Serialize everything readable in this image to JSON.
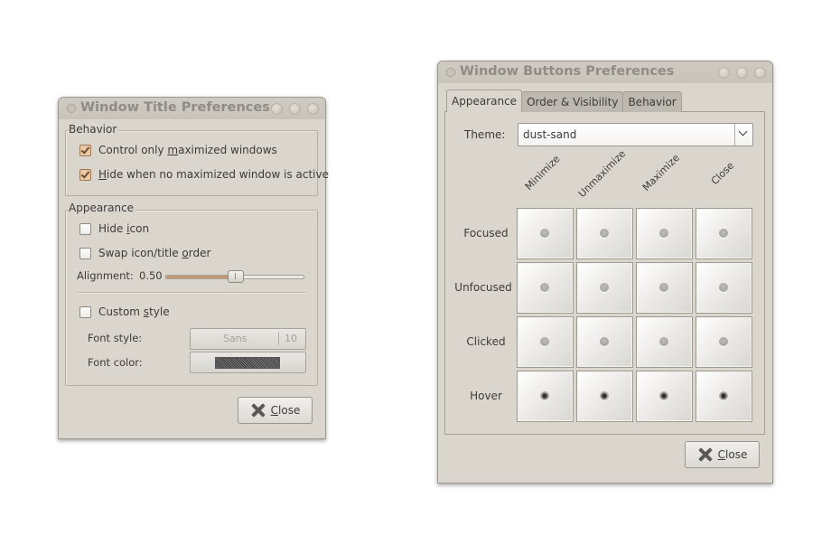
{
  "title_prefs": {
    "title": "Window Title Preferences",
    "behavior": {
      "label": "Behavior",
      "control_maximized": {
        "pre": "Control only ",
        "u": "m",
        "post": "aximized windows",
        "checked": true
      },
      "hide_when": {
        "pre": "",
        "u": "H",
        "post": "ide when no maximized window is active",
        "checked": true
      }
    },
    "appearance": {
      "label": "Appearance",
      "hide_icon": {
        "pre": "Hide ",
        "u": "i",
        "post": "con",
        "checked": false
      },
      "swap_order": {
        "pre": "Swap icon/title ",
        "u": "o",
        "post": "rder",
        "checked": false
      },
      "alignment_label": "Alignment:",
      "alignment_value": "0.50",
      "alignment_fraction": 0.5,
      "custom_style": {
        "pre": "Custom ",
        "u": "s",
        "post": "tyle",
        "checked": false
      },
      "font_style_label": "Font style:",
      "font_name": "Sans",
      "font_size": "10",
      "font_color_label": "Font color:"
    },
    "close": {
      "u": "C",
      "post": "lose"
    }
  },
  "buttons_prefs": {
    "title": "Window Buttons Preferences",
    "tabs": [
      "Appearance",
      "Order & Visibility",
      "Behavior"
    ],
    "active_tab": 0,
    "theme_label": "Theme:",
    "theme_value": "dust-sand",
    "columns": [
      "Minimize",
      "Unmaximize",
      "Maximize",
      "Close"
    ],
    "rows": [
      "Focused",
      "Unfocused",
      "Clicked",
      "Hover"
    ],
    "close": {
      "u": "C",
      "post": "lose"
    }
  },
  "icons": {
    "close": "close-x-icon",
    "window_menu": "window-menu-icon",
    "combo_arrow": "chevron-down-icon"
  }
}
